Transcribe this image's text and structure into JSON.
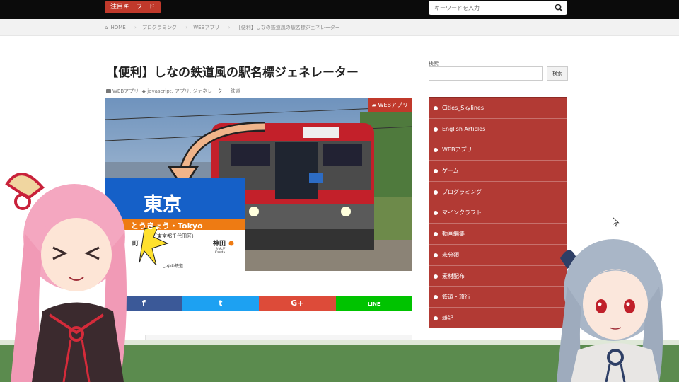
{
  "header": {
    "hot_keywords_label": "注目キーワード",
    "search_placeholder": "キーワードを入力"
  },
  "breadcrumb": {
    "items": [
      "HOME",
      "プログラミング",
      "WEBアプリ",
      "【便利】しなの鉄道風の駅名標ジェネレーター"
    ]
  },
  "article": {
    "title": "【便利】しなの鉄道風の駅名標ジェネレーター",
    "category": "WEBアプリ",
    "tags": "javascript, アプリ, ジェネレーター, 鉄道",
    "hero_badge": "WEBアプリ",
    "sign": {
      "station": "東京",
      "reading": "とうきょう・Tokyo",
      "area": "（東京都千代田区）",
      "prev_fragment": "町",
      "next_station": "神田",
      "next_reading": "かんだ",
      "next_roman": "Kanda",
      "company": "しなの鉄道"
    },
    "share": {
      "facebook": "f",
      "twitter": "t",
      "gplus": "G+",
      "line": "LINE"
    }
  },
  "sidebar": {
    "search_label": "検索",
    "search_button": "検索",
    "categories": [
      "Cities_Skylines",
      "English Articles",
      "WEBアプリ",
      "ゲーム",
      "プログラミング",
      "マインクラフト",
      "動画編集",
      "未分類",
      "素材配布",
      "鉄道・旅行",
      "雑記"
    ]
  },
  "colors": {
    "accent_red": "#c0392b",
    "sidebar_red": "#b23a34",
    "facebook": "#3b5998",
    "twitter": "#1da1f2",
    "gplus": "#dd4b39",
    "line": "#00c300"
  }
}
